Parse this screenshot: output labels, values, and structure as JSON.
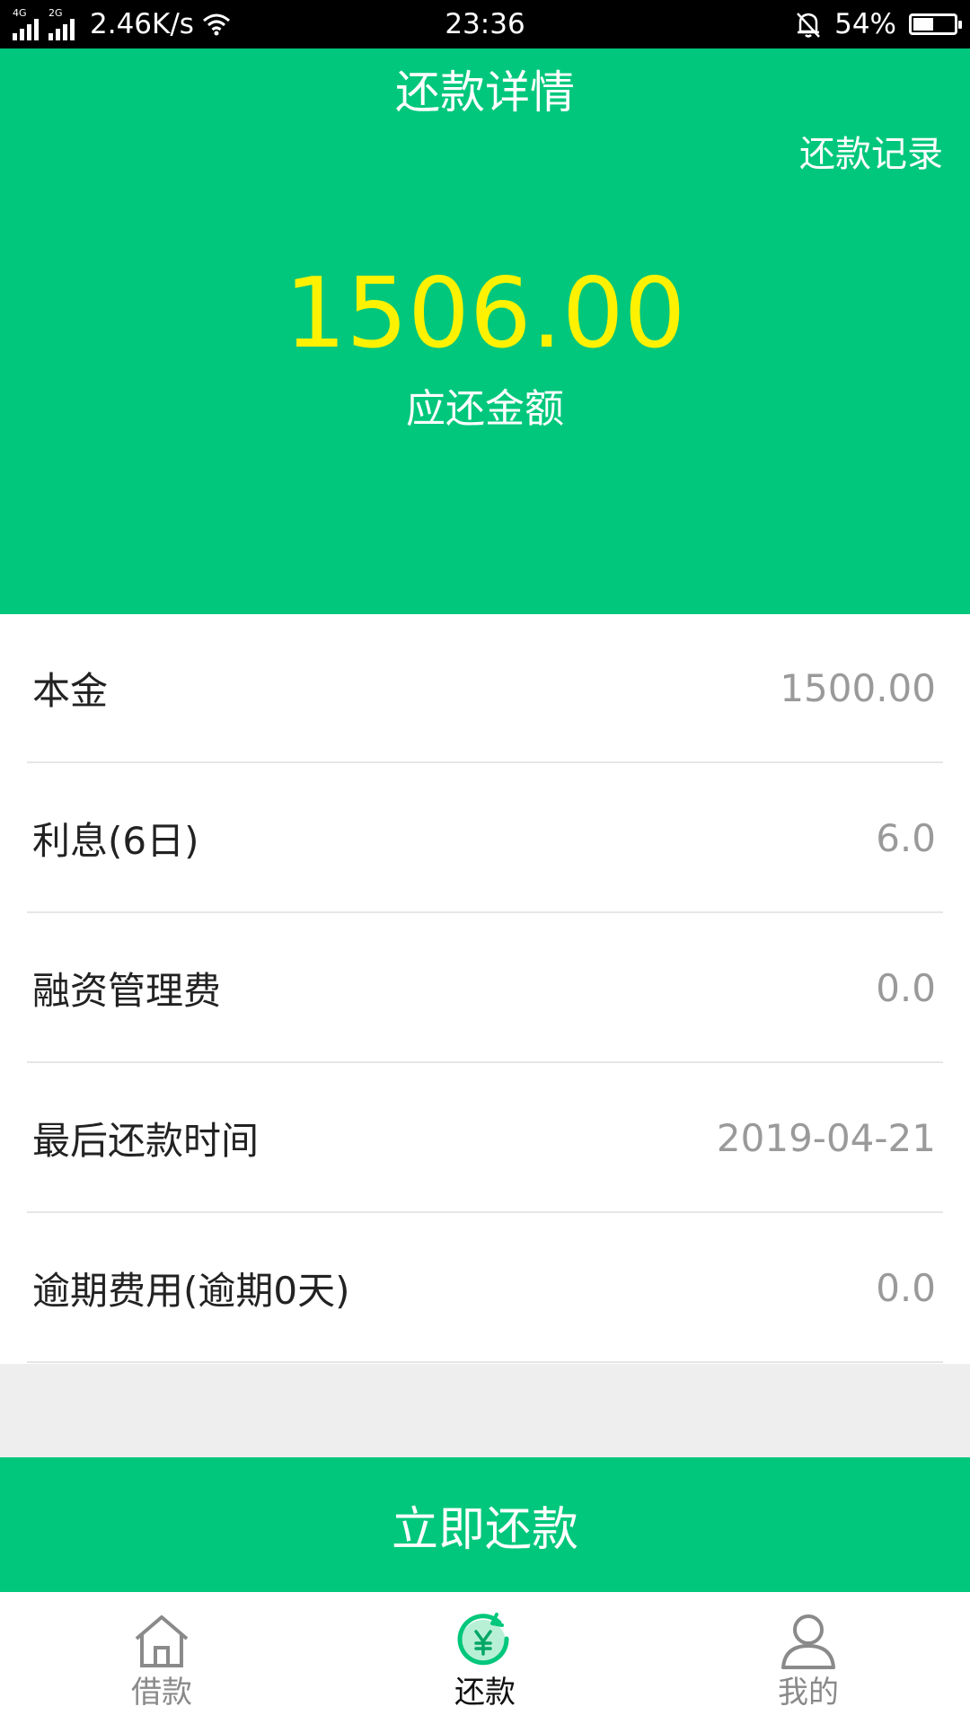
{
  "status_bar": {
    "net1": "4G",
    "net2": "2G",
    "speed": "2.46K/s",
    "time": "23:36",
    "battery": "54%",
    "battery_level": 0.54
  },
  "header": {
    "title": "还款详情",
    "record_link": "还款记录",
    "amount": "1506.00",
    "amount_label": "应还金额"
  },
  "details": [
    {
      "label": "本金",
      "value": "1500.00"
    },
    {
      "label": "利息(6日)",
      "value": "6.0"
    },
    {
      "label": "融资管理费",
      "value": "0.0"
    },
    {
      "label": "最后还款时间",
      "value": "2019-04-21"
    },
    {
      "label": "逾期费用(逾期0天)",
      "value": "0.0"
    }
  ],
  "pay_button": "立即还款",
  "nav": [
    {
      "label": "借款",
      "icon": "home-icon",
      "active": false
    },
    {
      "label": "还款",
      "icon": "repay-icon",
      "active": true
    },
    {
      "label": "我的",
      "icon": "user-icon",
      "active": false
    }
  ],
  "colors": {
    "brand": "#00c77b",
    "amount": "#fff200"
  }
}
